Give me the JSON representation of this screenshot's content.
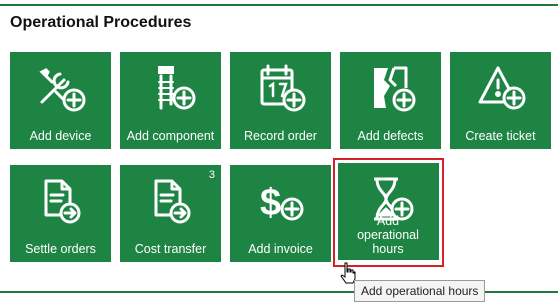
{
  "section": {
    "title": "Operational Procedures"
  },
  "tiles": [
    {
      "label": "Add device",
      "icon": "wrench-add-icon"
    },
    {
      "label": "Add component",
      "icon": "bolt-add-icon"
    },
    {
      "label": "Record order",
      "icon": "calendar-edit-icon"
    },
    {
      "label": "Add defects",
      "icon": "broken-document-add-icon"
    },
    {
      "label": "Create ticket",
      "icon": "warning-euro-add-icon"
    },
    {
      "label": "Settle orders",
      "icon": "document-arrow-icon"
    },
    {
      "label": "Cost transfer",
      "icon": "document-arrow-icon",
      "badge": "3"
    },
    {
      "label": "Add invoice",
      "icon": "dollar-add-icon"
    },
    {
      "label": "Add operational hours",
      "icon": "hourglass-add-icon"
    }
  ],
  "tooltip": {
    "text": "Add operational hours"
  },
  "colors": {
    "tile": "#1e8443",
    "rule": "#1e7a3c",
    "selection": "#d62027"
  }
}
